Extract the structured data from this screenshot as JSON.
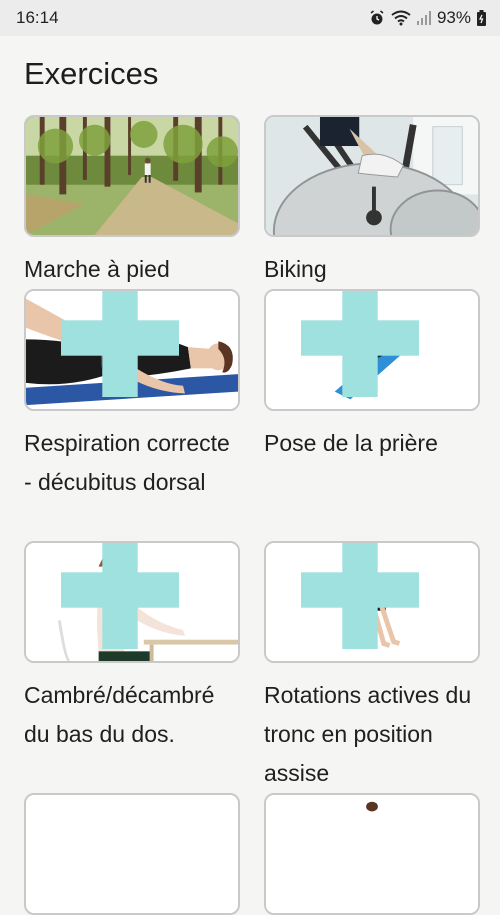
{
  "status_bar": {
    "time": "16:14",
    "battery": "93%"
  },
  "title": "Exercices",
  "exercises": [
    {
      "label": "Marche à pied"
    },
    {
      "label": "Biking"
    },
    {
      "label": "Respiration correcte - décubitus dorsal"
    },
    {
      "label": "Pose de la prière"
    },
    {
      "label": "Cambré/décambré du bas du dos."
    },
    {
      "label": "Rotations actives du tronc en position assise"
    }
  ]
}
